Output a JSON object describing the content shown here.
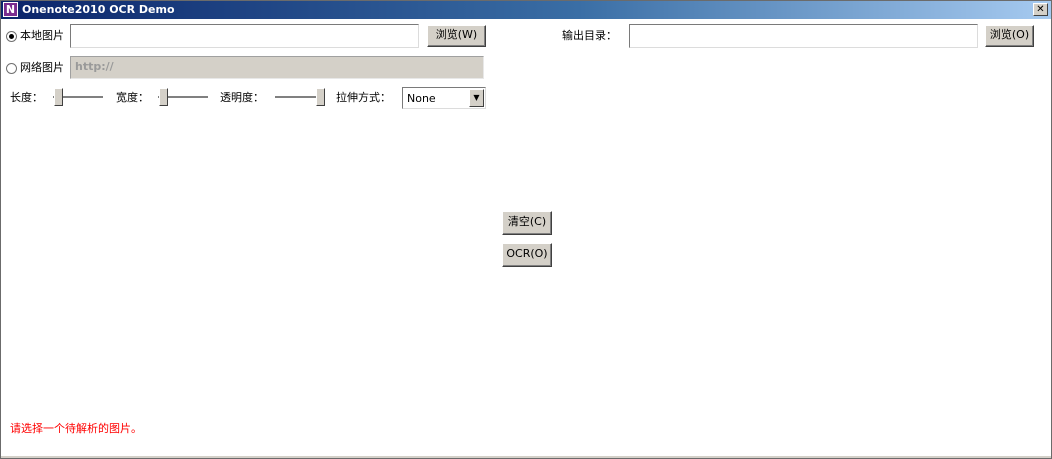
{
  "window": {
    "title": "Onenote2010 OCR Demo",
    "icon": "onenote-icon",
    "icon_letter": "N",
    "close_symbol": "✕"
  },
  "source": {
    "local_label": "本地图片",
    "local_selected": true,
    "local_path_value": "",
    "browse_label": "浏览(W)",
    "web_label": "网络图片",
    "web_selected": false,
    "web_url_value": "http://"
  },
  "output": {
    "label": "输出目录：",
    "path_value": "",
    "browse_label": "浏览(O)"
  },
  "settings": {
    "length_label": "长度：",
    "width_label": "宽度：",
    "opacity_label": "透明度：",
    "stretch_label": "拉伸方式：",
    "length_level": 0,
    "width_level": 0,
    "opacity_level": 1,
    "stretch_value": "None",
    "dropdown_arrow": "▼"
  },
  "actions": {
    "clear_label": "清空(C)",
    "ocr_label": "OCR(O)"
  },
  "status": {
    "message": "请选择一个待解析的图片。",
    "color": "#ff0000"
  }
}
